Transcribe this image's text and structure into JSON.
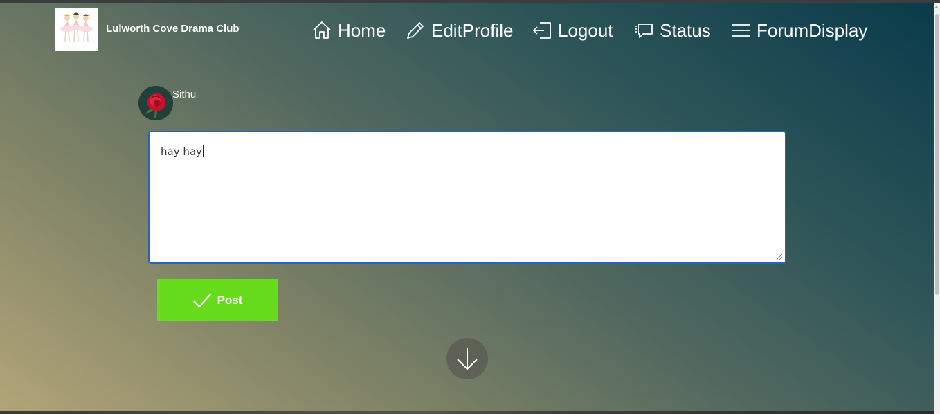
{
  "site": {
    "title": "Lulworth Cove Drama Club",
    "logo": "three-ballerinas-logo"
  },
  "nav": {
    "items": [
      {
        "label": "Home",
        "icon": "home-icon"
      },
      {
        "label": "EditProfile",
        "icon": "pencil-icon"
      },
      {
        "label": "Logout",
        "icon": "logout-icon"
      },
      {
        "label": "Status",
        "icon": "chat-bubble-icon"
      },
      {
        "label": "ForumDisplay",
        "icon": "menu-icon"
      }
    ]
  },
  "user": {
    "name": "Sithu",
    "avatar": "red-rose-avatar"
  },
  "composer": {
    "value": "hay hay",
    "post_label": "Post",
    "post_icon": "checkmark-icon"
  },
  "scroll": {
    "icon": "arrow-down-icon"
  },
  "colors": {
    "post_button": "#66dc1d",
    "input_focus_border": "#2b63b4",
    "gradient_dark": "#0a3a4b",
    "gradient_light": "#b2a478"
  }
}
